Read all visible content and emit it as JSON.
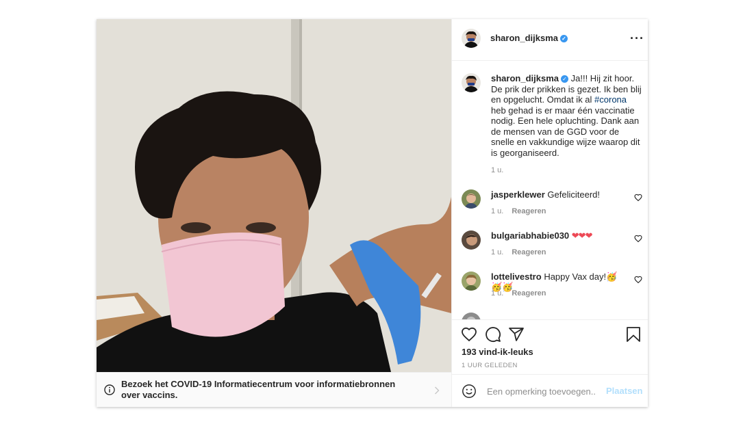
{
  "post": {
    "author": "sharon_dijksma",
    "verified": true,
    "caption": {
      "text_before": "Ja!!! Hij zit hoor. De prik der prikken is gezet. Ik ben blij en opgelucht. Omdat ik al ",
      "hashtag": "#corona",
      "text_after": " heb gehad is er maar één vaccinatie nodig. Een hele opluchting. Dank aan de mensen van de GGD voor de snelle en vakkundige wijze waarop dit is georganiseerd.",
      "time": "1 u."
    },
    "comments": [
      {
        "user": "jasperklewer",
        "text": "Gefeliciteerd!",
        "time": "1 u.",
        "reply": "Reageren"
      },
      {
        "user": "bulgariabhabie030",
        "text": "❤❤❤",
        "time": "1 u.",
        "reply": "Reageren"
      },
      {
        "user": "lottelivestro",
        "text": "Happy Vax day!🥳🥳🥳",
        "time": "1 u.",
        "reply": "Reageren"
      }
    ],
    "likes": "193 vind-ik-leuks",
    "posted_ago": "1 UUR GELEDEN",
    "comment_input_placeholder": "Een opmerking toevoegen...",
    "post_button": "Plaatsen",
    "covid_banner": "Bezoek het COVID-19 Informatiecentrum voor informatiebronnen over vaccins."
  },
  "icons": {
    "like": "heart-icon",
    "comment": "comment-icon",
    "share": "paper-plane-icon",
    "save": "bookmark-icon",
    "more": "more-options-icon",
    "info": "info-icon",
    "emoji": "emoji-icon"
  },
  "colors": {
    "verified": "#3897f0",
    "hashtag": "#00376b",
    "hearts": "#ed4956",
    "post_button_disabled": "#b2dffc",
    "mask": "#f2c6d3",
    "glove": "#3f86d8"
  }
}
